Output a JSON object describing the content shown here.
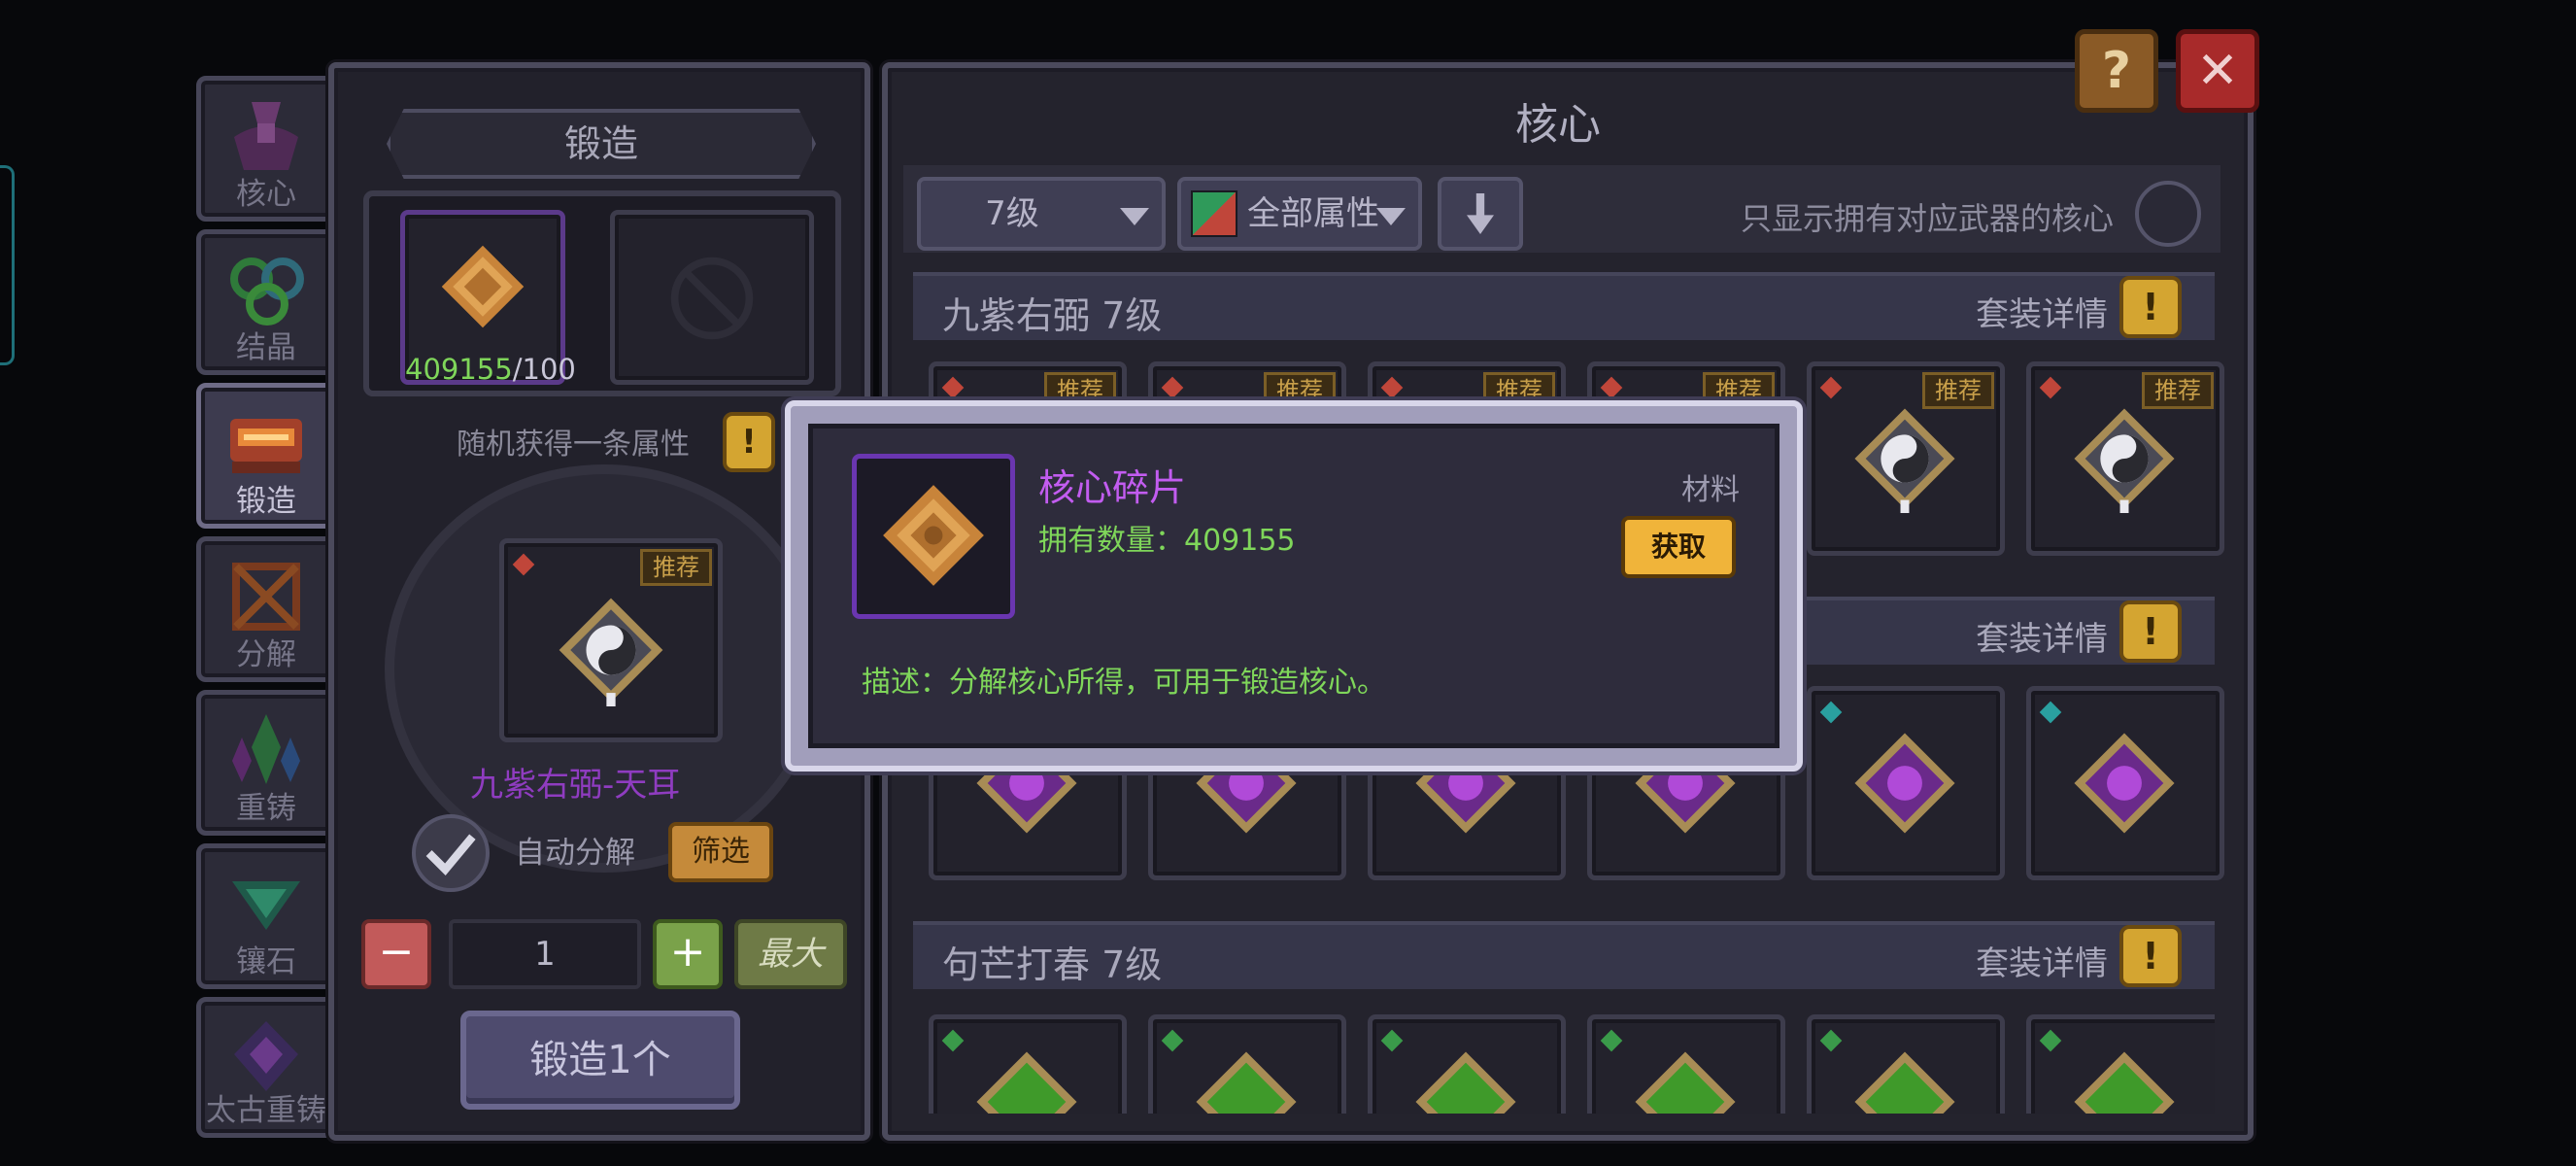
{
  "side_tabs": [
    {
      "label": "核心",
      "active": false
    },
    {
      "label": "结晶",
      "active": false
    },
    {
      "label": "锻造",
      "active": true
    },
    {
      "label": "分解",
      "active": false
    },
    {
      "label": "重铸",
      "active": false
    },
    {
      "label": "镶石",
      "active": false
    },
    {
      "label": "太古重铸",
      "active": false
    }
  ],
  "forge_panel": {
    "title": "锻造",
    "material_have": "409155",
    "material_need": "/100",
    "random_attr_label": "随机获得一条属性",
    "selected_core_name": "九紫右弼-天耳",
    "recommend_tag": "推荐",
    "auto_decompose_label": "自动分解",
    "filter_button": "筛选",
    "quantity": "1",
    "max_button": "最大",
    "forge_button": "锻造1个",
    "minus_symbol": "−",
    "plus_symbol": "+"
  },
  "core_panel": {
    "title": "核心",
    "level_select": "7级",
    "attribute_select": "全部属性",
    "only_owned_label": "只显示拥有对应武器的核心",
    "sets": [
      {
        "name": "九紫右弼 7级",
        "detail": "套装详情"
      },
      {
        "name": "",
        "detail": "套装详情"
      },
      {
        "name": "句芒打春 7级",
        "detail": "套装详情"
      }
    ],
    "recommend_tag": "推荐"
  },
  "top_buttons": {
    "help": "?",
    "close": "✕"
  },
  "popup": {
    "item_name": "核心碎片",
    "category": "材料",
    "owned_label": "拥有数量：409155",
    "obtain_button": "获取",
    "description": "描述：分解核心所得，可用于锻造核心。"
  },
  "colors": {
    "purple_text": "#c25cf0",
    "green_text": "#7fd65a",
    "gold_button": "#f0b43a",
    "set_purple": "#8f3cc0",
    "set_green": "#3f9a2a"
  }
}
